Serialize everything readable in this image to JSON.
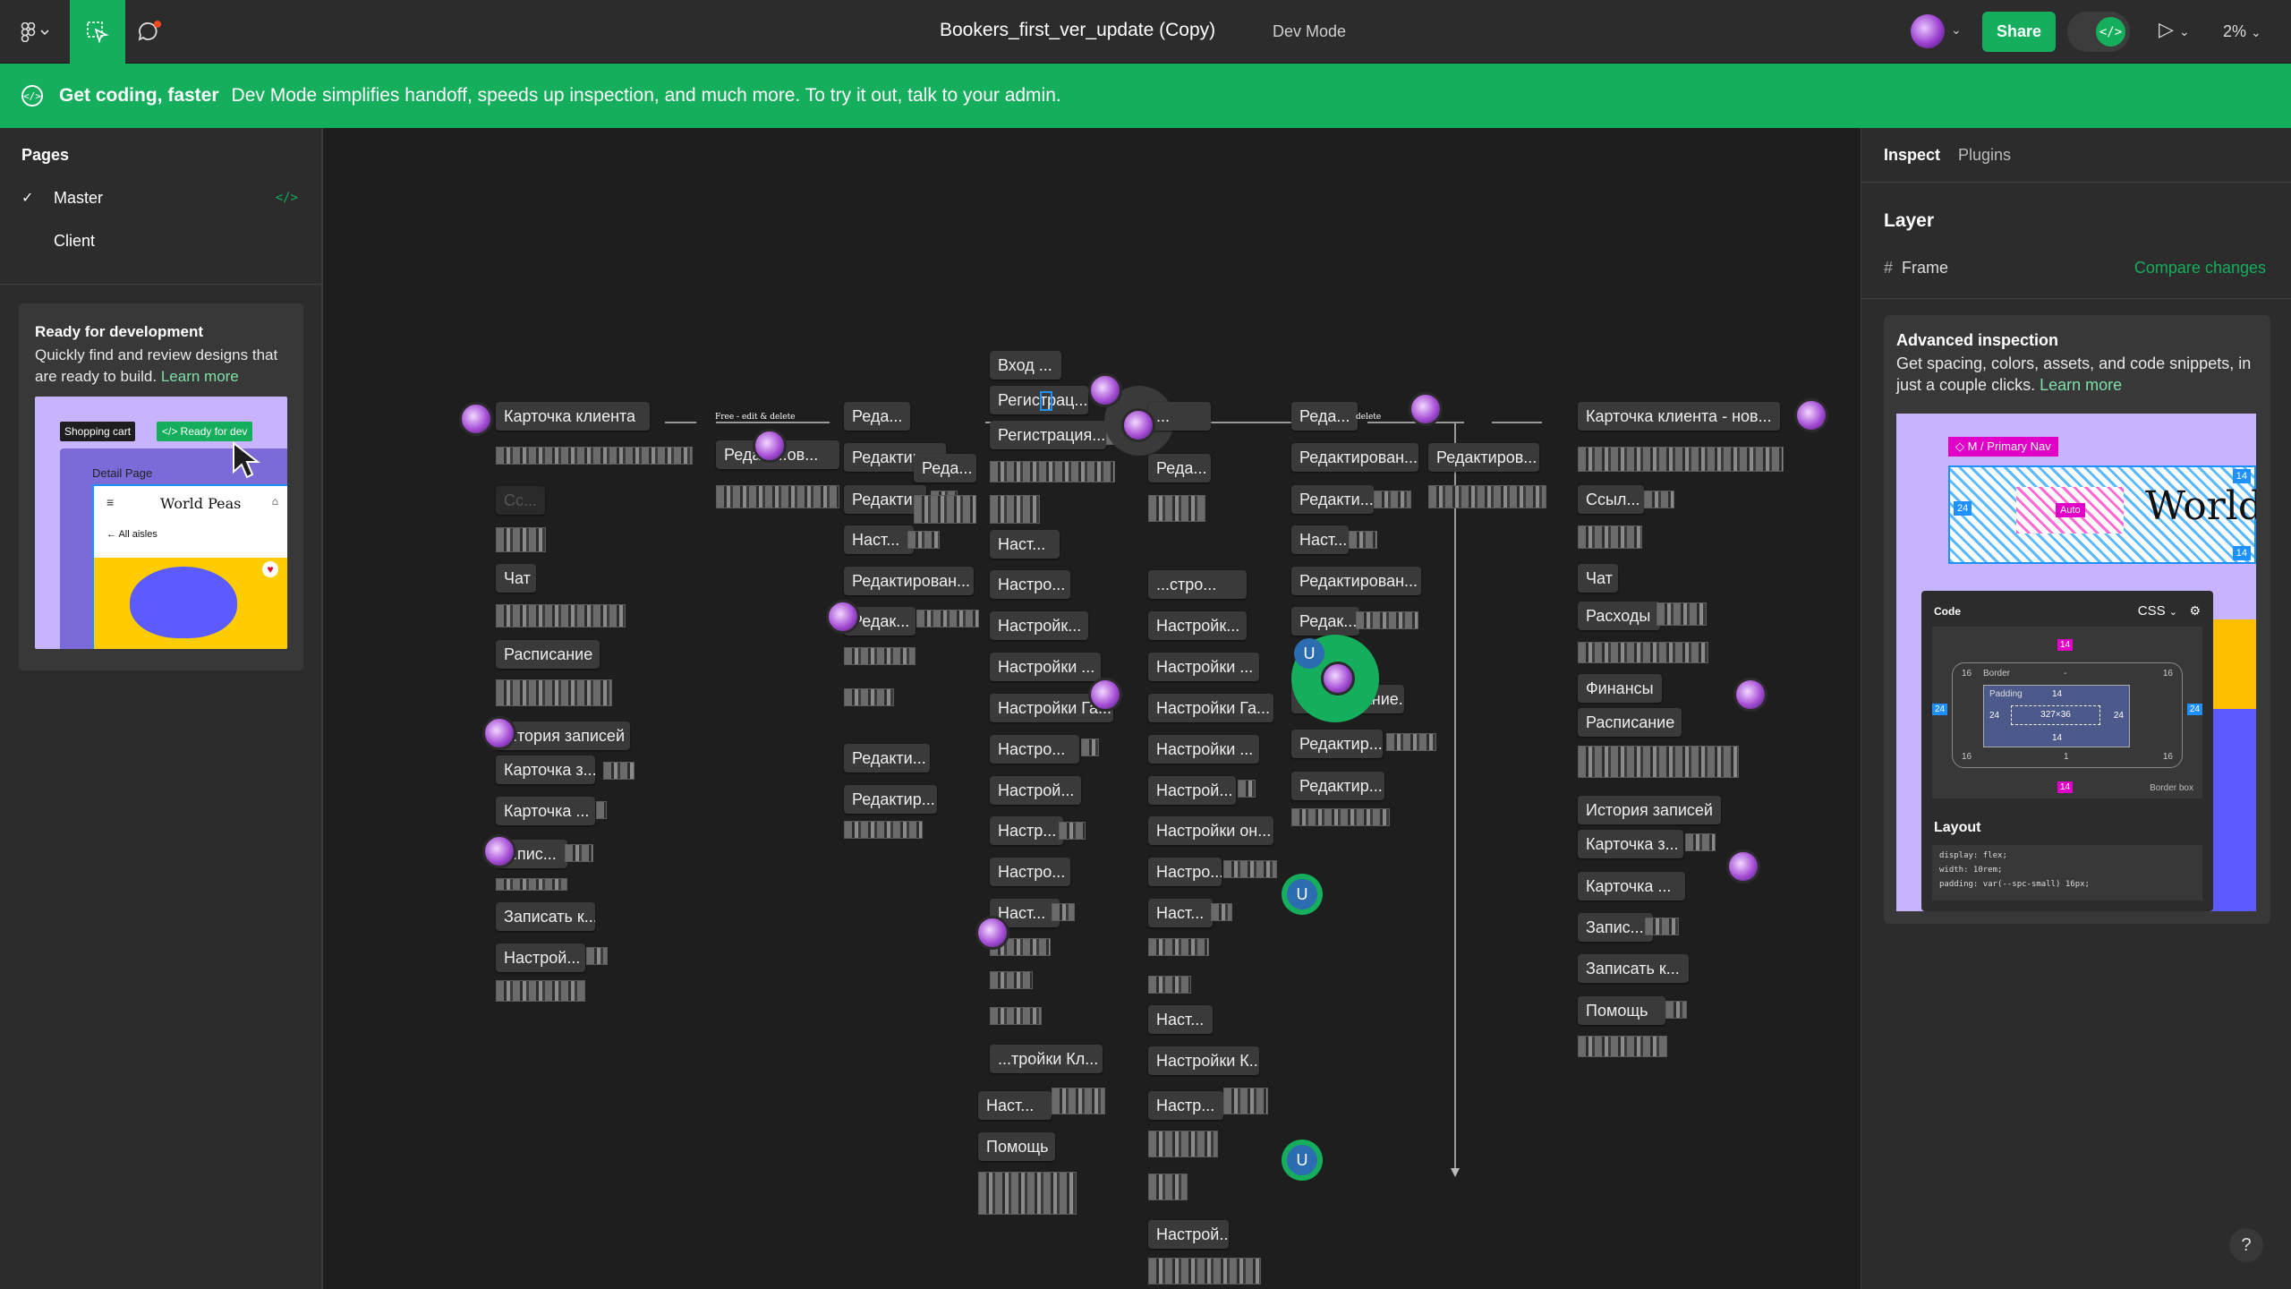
{
  "topbar": {
    "doc_title": "Bookers_first_ver_update (Copy)",
    "mode_label": "Dev Mode",
    "share_label": "Share",
    "zoom": "2%",
    "dev_toggle_glyph": "</>"
  },
  "banner": {
    "strong": "Get coding, faster",
    "text": "Dev Mode simplifies handoff, speeds up inspection, and much more. To try it out, talk to your admin."
  },
  "pages": {
    "title": "Pages",
    "items": [
      {
        "label": "Master",
        "selected": true,
        "dev_glyph": "</>"
      },
      {
        "label": "Client",
        "selected": false
      }
    ]
  },
  "ready_card": {
    "title": "Ready for development",
    "body": "Quickly find and review designs that are ready to build.",
    "link": "Learn more",
    "preview": {
      "tag_shopping": "Shopping cart",
      "tag_ready": "</> Ready for dev",
      "detail_page": "Detail Page",
      "brand": "World Peas",
      "back": "← All aisles"
    }
  },
  "canvas": {
    "nodes": [
      "Вход ...",
      "Регистрац...",
      "Регистрация...",
      "Реда...",
      "Реда...",
      "Карточка клиента",
      "Реда...",
      "Реда...",
      "Наст...",
      "...",
      "Реда...",
      "Карточка клиента - нов...",
      "Редакт...ов...",
      "Редактиро...",
      "Настро...",
      "...стро...",
      "Редактирован...",
      "Редактиров...",
      "Сс...",
      "Редакти...",
      "Настройк...",
      "Настройк...",
      "Редакти...",
      "Ссыл...",
      "Наст...",
      "Настройки ...",
      "Настройки ...",
      "Наст...",
      "Чат",
      "Редактирован...",
      "Настройки Га...",
      "Настройки Га...",
      "Редактирован...",
      "Чат",
      "Редак...",
      "Настро...",
      "Настройки ...",
      "Редак...",
      "Расходы",
      "Расписание",
      "Настрой...",
      "Настрой...",
      "Настр...",
      "Настройки он...",
      "...ктирование...",
      "Финансы",
      "...тория записей",
      "Редакти...",
      "Настро...",
      "Настро...",
      "Редактир...",
      "Расписание",
      "Карточка з...",
      "Редактир...",
      "Наст...",
      "Наст...",
      "Редактир...",
      "Карточка ...",
      "История записей",
      "...пис...",
      "Карточка з...",
      "Записать к...",
      "Наст...",
      "Карточка ...",
      "Настрой...",
      "...тройки Кл...",
      "Настройки К...",
      "Запис...",
      "Наст...",
      "Настр...",
      "Записать к...",
      "Помощь",
      "Настрой...",
      "Помощь"
    ],
    "labels": [
      "Free - edit & delete",
      "delete"
    ],
    "avatar_letter": "U"
  },
  "inspect": {
    "tabs": [
      "Inspect",
      "Plugins"
    ],
    "layer_title": "Layer",
    "frame_label": "Frame",
    "compare_label": "Compare changes",
    "advanced": {
      "title": "Advanced inspection",
      "body": "Get spacing, colors, assets, and code snippets, in just a couple clicks.",
      "link": "Learn more",
      "preview": {
        "nav_tag": "◇ M / Primary Nav",
        "auto": "Auto",
        "world": "World",
        "code_title": "Code",
        "css": "CSS",
        "border": "Border",
        "padding": "Padding",
        "size": "327×36",
        "border_box": "Border box",
        "layout": "Layout",
        "code_lines": [
          "display: flex;",
          "width: 10rem;",
          "padding: var(--spc-small) 16px;"
        ],
        "n14": "14",
        "n16": "16",
        "n24": "24",
        "n1": "1",
        "dash": "-"
      }
    }
  },
  "help": "?"
}
